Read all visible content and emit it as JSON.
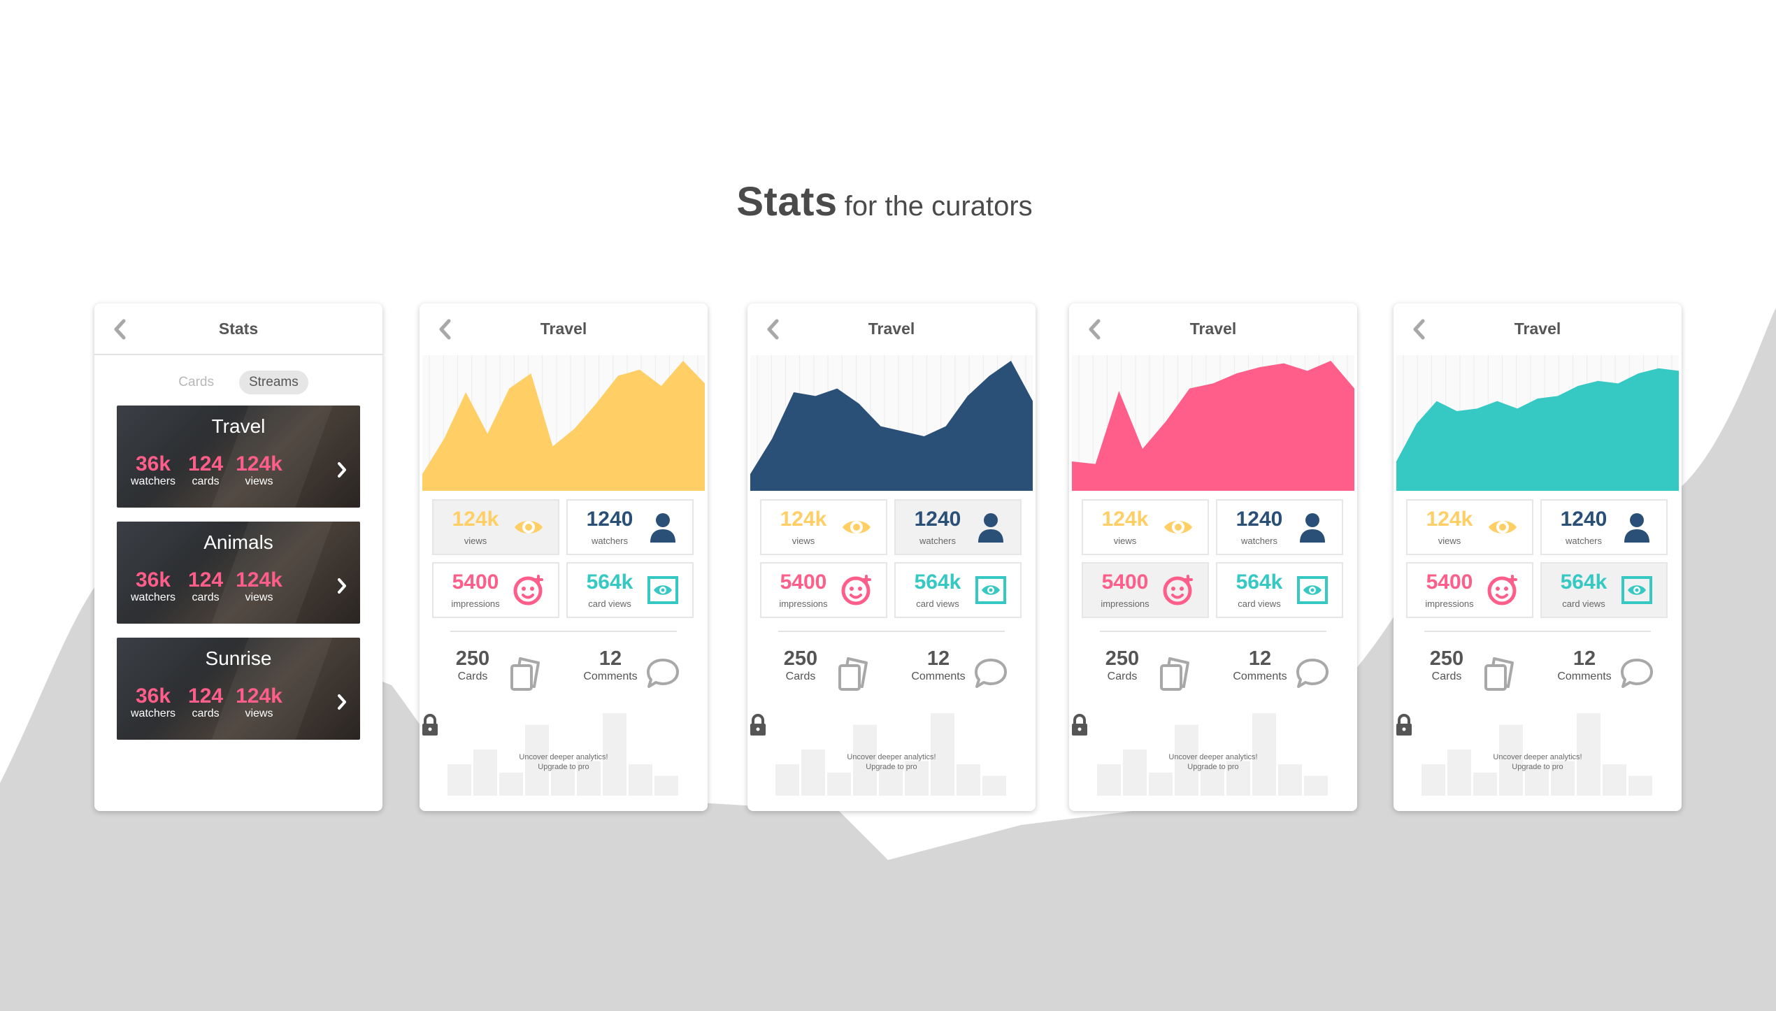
{
  "headline": {
    "strong": "Stats",
    "light": "for the curators"
  },
  "list_phone": {
    "title": "Stats",
    "tabs": [
      {
        "label": "Cards",
        "active": false
      },
      {
        "label": "Streams",
        "active": true
      }
    ],
    "streams": [
      {
        "title": "Travel",
        "watchers": "36k",
        "watchers_label": "watchers",
        "cards": "124",
        "cards_label": "cards",
        "views": "124k",
        "views_label": "views"
      },
      {
        "title": "Animals",
        "watchers": "36k",
        "watchers_label": "watchers",
        "cards": "124",
        "cards_label": "cards",
        "views": "124k",
        "views_label": "views"
      },
      {
        "title": "Sunrise",
        "watchers": "36k",
        "watchers_label": "watchers",
        "cards": "124",
        "cards_label": "cards",
        "views": "124k",
        "views_label": "views"
      }
    ]
  },
  "stat_screens": [
    {
      "title": "Travel",
      "accent": "#ffcf66",
      "highlight": "views",
      "tiles": {
        "views": {
          "value": "124k",
          "label": "views",
          "icon": "eye-icon"
        },
        "watchers": {
          "value": "1240",
          "label": "watchers",
          "icon": "person-icon"
        },
        "impressions": {
          "value": "5400",
          "label": "impressions",
          "icon": "face-icon"
        },
        "card_views": {
          "value": "564k",
          "label": "card views",
          "icon": "card-eye-icon"
        }
      },
      "cards": {
        "value": "250",
        "label": "Cards"
      },
      "comments": {
        "value": "12",
        "label": "Comments"
      },
      "locked": {
        "line1": "Uncover deeper analytics!",
        "line2": "Upgrade to pro"
      }
    },
    {
      "title": "Travel",
      "accent": "#2b5078",
      "highlight": "watchers",
      "tiles": {
        "views": {
          "value": "124k",
          "label": "views",
          "icon": "eye-icon"
        },
        "watchers": {
          "value": "1240",
          "label": "watchers",
          "icon": "person-icon"
        },
        "impressions": {
          "value": "5400",
          "label": "impressions",
          "icon": "face-icon"
        },
        "card_views": {
          "value": "564k",
          "label": "card views",
          "icon": "card-eye-icon"
        }
      },
      "cards": {
        "value": "250",
        "label": "Cards"
      },
      "comments": {
        "value": "12",
        "label": "Comments"
      },
      "locked": {
        "line1": "Uncover deeper analytics!",
        "line2": "Upgrade to pro"
      }
    },
    {
      "title": "Travel",
      "accent": "#ff5d8a",
      "highlight": "impressions",
      "tiles": {
        "views": {
          "value": "124k",
          "label": "views",
          "icon": "eye-icon"
        },
        "watchers": {
          "value": "1240",
          "label": "watchers",
          "icon": "person-icon"
        },
        "impressions": {
          "value": "5400",
          "label": "impressions",
          "icon": "face-icon"
        },
        "card_views": {
          "value": "564k",
          "label": "card views",
          "icon": "card-eye-icon"
        }
      },
      "cards": {
        "value": "250",
        "label": "Cards"
      },
      "comments": {
        "value": "12",
        "label": "Comments"
      },
      "locked": {
        "line1": "Uncover deeper analytics!",
        "line2": "Upgrade to pro"
      }
    },
    {
      "title": "Travel",
      "accent": "#36c8c3",
      "highlight": "card_views",
      "tiles": {
        "views": {
          "value": "124k",
          "label": "views",
          "icon": "eye-icon"
        },
        "watchers": {
          "value": "1240",
          "label": "watchers",
          "icon": "person-icon"
        },
        "impressions": {
          "value": "5400",
          "label": "impressions",
          "icon": "face-icon"
        },
        "card_views": {
          "value": "564k",
          "label": "card views",
          "icon": "card-eye-icon"
        }
      },
      "cards": {
        "value": "250",
        "label": "Cards"
      },
      "comments": {
        "value": "12",
        "label": "Comments"
      },
      "locked": {
        "line1": "Uncover deeper analytics!",
        "line2": "Upgrade to pro"
      }
    }
  ],
  "chart_data": [
    {
      "type": "area",
      "series": [
        {
          "values": [
            10,
            38,
            75,
            42,
            78,
            90,
            32,
            46,
            66,
            88,
            93,
            80,
            100,
            82
          ]
        }
      ]
    },
    {
      "type": "area",
      "series": [
        {
          "values": [
            10,
            38,
            75,
            72,
            78,
            66,
            48,
            44,
            40,
            48,
            72,
            88,
            100,
            68
          ]
        }
      ]
    },
    {
      "type": "area",
      "series": [
        {
          "values": [
            20,
            18,
            76,
            30,
            52,
            78,
            82,
            90,
            95,
            98,
            92,
            100,
            78
          ]
        }
      ]
    },
    {
      "type": "area",
      "series": [
        {
          "values": [
            20,
            50,
            68,
            60,
            62,
            68,
            62,
            70,
            72,
            80,
            84,
            82,
            90,
            94,
            92
          ]
        }
      ]
    }
  ],
  "locked_bars": [
    0.38,
    0.56,
    0.28,
    0.86,
    0.36,
    0.42,
    1.0,
    0.38,
    0.24
  ]
}
